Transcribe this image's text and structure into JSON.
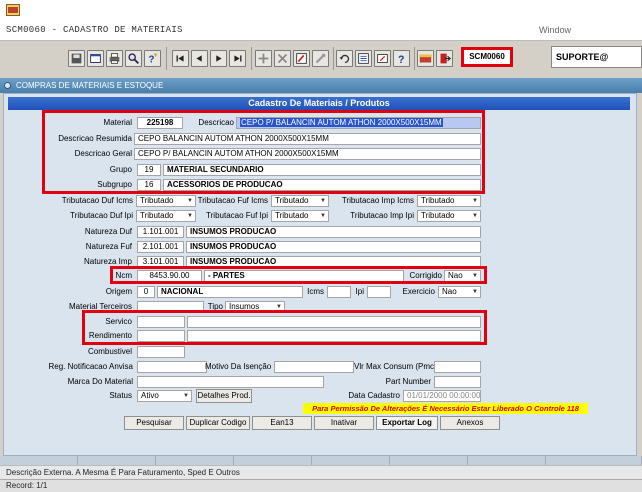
{
  "window": {
    "title": "SCM0060 - CADASTRO DE MATERIAIS",
    "menu": "Window"
  },
  "toolbar": {
    "screen_code": "SCM0060",
    "user": "SUPORTE@"
  },
  "module": {
    "title": "COMPRAS DE MATERIAIS E ESTOQUE"
  },
  "form": {
    "title": "Cadastro De Materiais / Produtos",
    "material": {
      "label": "Material",
      "value": "225198"
    },
    "descricao": {
      "label": "Descricao",
      "value": "CEPO P/ BALANCIN AUTOM ATHON 2000X500X15MM"
    },
    "descricao_resumida": {
      "label": "Descricao Resumida",
      "value": "CEPO BALANCIN AUTOM ATHON 2000X500X15MM"
    },
    "descricao_geral": {
      "label": "Descricao Geral",
      "value": "CEPO P/ BALANCIN AUTOM ATHON 2000X500X15MM"
    },
    "grupo": {
      "label": "Grupo",
      "code": "19",
      "name": "MATERIAL SECUNDARIO"
    },
    "subgrupo": {
      "label": "Subgrupo",
      "code": "16",
      "name": "ACESSORIOS DE PRODUCAO"
    },
    "trib_duf_icms": {
      "label": "Tributacao Duf Icms",
      "value": "Tributado"
    },
    "trib_fuf_icms": {
      "label": "Tributacao Fuf Icms",
      "value": "Tributado"
    },
    "trib_imp_icms": {
      "label": "Tributacao Imp Icms",
      "value": "Tributado"
    },
    "trib_duf_ipi": {
      "label": "Tributacao Duf Ipi",
      "value": "Tributado"
    },
    "trib_fuf_ipi": {
      "label": "Tributacao Fuf Ipi",
      "value": "Tributado"
    },
    "trib_imp_ipi": {
      "label": "Tributacao Imp Ipi",
      "value": "Tributado"
    },
    "natureza_duf": {
      "label": "Natureza Duf",
      "code": "1.101.001",
      "name": "INSUMOS PRODUCAO"
    },
    "natureza_fuf": {
      "label": "Natureza Fuf",
      "code": "2.101.001",
      "name": "INSUMOS PRODUCAO"
    },
    "natureza_imp": {
      "label": "Natureza Imp",
      "code": "3.101.001",
      "name": "INSUMOS PRODUCAO"
    },
    "ncm": {
      "label": "Ncm",
      "code": "8453.90.00",
      "name": "- PARTES"
    },
    "corrigido": {
      "label": "Corrigido",
      "value": "Nao"
    },
    "origem": {
      "label": "Origem",
      "code": "0",
      "name": "NACIONAL"
    },
    "icms": {
      "label": "Icms",
      "value": ""
    },
    "ipi": {
      "label": "Ipi",
      "value": ""
    },
    "exercicio": {
      "label": "Exercicio",
      "value": "Nao"
    },
    "material_terceiros": {
      "label": "Material Terceiros",
      "value": ""
    },
    "tipo": {
      "label": "Tipo",
      "value": "Insumos"
    },
    "servico": {
      "label": "Servico",
      "value": ""
    },
    "rendimento": {
      "label": "Rendimento",
      "value": ""
    },
    "combustivel": {
      "label": "Combustivel",
      "value": ""
    },
    "reg_anvisa": {
      "label": "Reg. Notificacao Anvisa",
      "value": ""
    },
    "motivo_isencao": {
      "label": "Motivo Da Isenção",
      "value": ""
    },
    "vlr_max_consum": {
      "label": "Vlr Max Consum (Pmc)",
      "value": ""
    },
    "marca": {
      "label": "Marca Do Material",
      "value": ""
    },
    "part_number": {
      "label": "Part Number",
      "value": ""
    },
    "status": {
      "label": "Status",
      "value": "Ativo"
    },
    "detalhes_prod": "Detalhes Prod.",
    "data_cadastro": {
      "label": "Data Cadastro",
      "value": "01/01/2000 00:00:00"
    },
    "notice": "Para Permissão De Alterações É Necessário Estar Liberado O Controle 118"
  },
  "actions": {
    "pesquisar": "Pesquisar",
    "duplicar": "Duplicar Codigo",
    "ean13": "Ean13",
    "inativar": "Inativar",
    "exportar_log": "Exportar Log",
    "anexos": "Anexos"
  },
  "status": {
    "message": "Descrição Externa. A Mesma É Para Faturamento, Sped E Outros",
    "record": "Record: 1/1"
  },
  "colors": {
    "highlight_red": "#e0000f",
    "panel_blue": "#2051b8",
    "notice_yellow": "#ffff00"
  }
}
